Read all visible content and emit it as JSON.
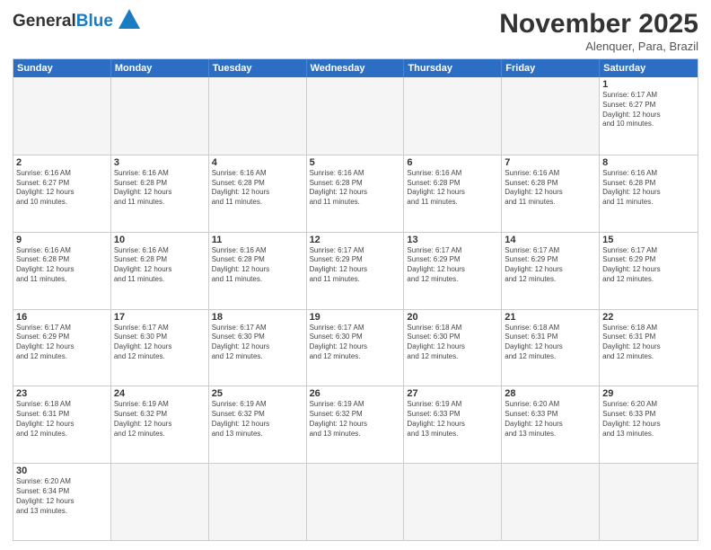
{
  "header": {
    "logo_general": "General",
    "logo_blue": "Blue",
    "month_title": "November 2025",
    "subtitle": "Alenquer, Para, Brazil"
  },
  "calendar": {
    "days_of_week": [
      "Sunday",
      "Monday",
      "Tuesday",
      "Wednesday",
      "Thursday",
      "Friday",
      "Saturday"
    ],
    "weeks": [
      [
        {
          "day": "",
          "info": "",
          "empty": true
        },
        {
          "day": "",
          "info": "",
          "empty": true
        },
        {
          "day": "",
          "info": "",
          "empty": true
        },
        {
          "day": "",
          "info": "",
          "empty": true
        },
        {
          "day": "",
          "info": "",
          "empty": true
        },
        {
          "day": "",
          "info": "",
          "empty": true
        },
        {
          "day": "1",
          "info": "Sunrise: 6:17 AM\nSunset: 6:27 PM\nDaylight: 12 hours\nand 10 minutes."
        }
      ],
      [
        {
          "day": "2",
          "info": "Sunrise: 6:16 AM\nSunset: 6:27 PM\nDaylight: 12 hours\nand 10 minutes."
        },
        {
          "day": "3",
          "info": "Sunrise: 6:16 AM\nSunset: 6:28 PM\nDaylight: 12 hours\nand 11 minutes."
        },
        {
          "day": "4",
          "info": "Sunrise: 6:16 AM\nSunset: 6:28 PM\nDaylight: 12 hours\nand 11 minutes."
        },
        {
          "day": "5",
          "info": "Sunrise: 6:16 AM\nSunset: 6:28 PM\nDaylight: 12 hours\nand 11 minutes."
        },
        {
          "day": "6",
          "info": "Sunrise: 6:16 AM\nSunset: 6:28 PM\nDaylight: 12 hours\nand 11 minutes."
        },
        {
          "day": "7",
          "info": "Sunrise: 6:16 AM\nSunset: 6:28 PM\nDaylight: 12 hours\nand 11 minutes."
        },
        {
          "day": "8",
          "info": "Sunrise: 6:16 AM\nSunset: 6:28 PM\nDaylight: 12 hours\nand 11 minutes."
        }
      ],
      [
        {
          "day": "9",
          "info": "Sunrise: 6:16 AM\nSunset: 6:28 PM\nDaylight: 12 hours\nand 11 minutes."
        },
        {
          "day": "10",
          "info": "Sunrise: 6:16 AM\nSunset: 6:28 PM\nDaylight: 12 hours\nand 11 minutes."
        },
        {
          "day": "11",
          "info": "Sunrise: 6:16 AM\nSunset: 6:28 PM\nDaylight: 12 hours\nand 11 minutes."
        },
        {
          "day": "12",
          "info": "Sunrise: 6:17 AM\nSunset: 6:29 PM\nDaylight: 12 hours\nand 11 minutes."
        },
        {
          "day": "13",
          "info": "Sunrise: 6:17 AM\nSunset: 6:29 PM\nDaylight: 12 hours\nand 12 minutes."
        },
        {
          "day": "14",
          "info": "Sunrise: 6:17 AM\nSunset: 6:29 PM\nDaylight: 12 hours\nand 12 minutes."
        },
        {
          "day": "15",
          "info": "Sunrise: 6:17 AM\nSunset: 6:29 PM\nDaylight: 12 hours\nand 12 minutes."
        }
      ],
      [
        {
          "day": "16",
          "info": "Sunrise: 6:17 AM\nSunset: 6:29 PM\nDaylight: 12 hours\nand 12 minutes."
        },
        {
          "day": "17",
          "info": "Sunrise: 6:17 AM\nSunset: 6:30 PM\nDaylight: 12 hours\nand 12 minutes."
        },
        {
          "day": "18",
          "info": "Sunrise: 6:17 AM\nSunset: 6:30 PM\nDaylight: 12 hours\nand 12 minutes."
        },
        {
          "day": "19",
          "info": "Sunrise: 6:17 AM\nSunset: 6:30 PM\nDaylight: 12 hours\nand 12 minutes."
        },
        {
          "day": "20",
          "info": "Sunrise: 6:18 AM\nSunset: 6:30 PM\nDaylight: 12 hours\nand 12 minutes."
        },
        {
          "day": "21",
          "info": "Sunrise: 6:18 AM\nSunset: 6:31 PM\nDaylight: 12 hours\nand 12 minutes."
        },
        {
          "day": "22",
          "info": "Sunrise: 6:18 AM\nSunset: 6:31 PM\nDaylight: 12 hours\nand 12 minutes."
        }
      ],
      [
        {
          "day": "23",
          "info": "Sunrise: 6:18 AM\nSunset: 6:31 PM\nDaylight: 12 hours\nand 12 minutes."
        },
        {
          "day": "24",
          "info": "Sunrise: 6:19 AM\nSunset: 6:32 PM\nDaylight: 12 hours\nand 12 minutes."
        },
        {
          "day": "25",
          "info": "Sunrise: 6:19 AM\nSunset: 6:32 PM\nDaylight: 12 hours\nand 13 minutes."
        },
        {
          "day": "26",
          "info": "Sunrise: 6:19 AM\nSunset: 6:32 PM\nDaylight: 12 hours\nand 13 minutes."
        },
        {
          "day": "27",
          "info": "Sunrise: 6:19 AM\nSunset: 6:33 PM\nDaylight: 12 hours\nand 13 minutes."
        },
        {
          "day": "28",
          "info": "Sunrise: 6:20 AM\nSunset: 6:33 PM\nDaylight: 12 hours\nand 13 minutes."
        },
        {
          "day": "29",
          "info": "Sunrise: 6:20 AM\nSunset: 6:33 PM\nDaylight: 12 hours\nand 13 minutes."
        }
      ],
      [
        {
          "day": "30",
          "info": "Sunrise: 6:20 AM\nSunset: 6:34 PM\nDaylight: 12 hours\nand 13 minutes."
        },
        {
          "day": "",
          "info": "",
          "empty": true
        },
        {
          "day": "",
          "info": "",
          "empty": true
        },
        {
          "day": "",
          "info": "",
          "empty": true
        },
        {
          "day": "",
          "info": "",
          "empty": true
        },
        {
          "day": "",
          "info": "",
          "empty": true
        },
        {
          "day": "",
          "info": "",
          "empty": true
        }
      ]
    ]
  }
}
